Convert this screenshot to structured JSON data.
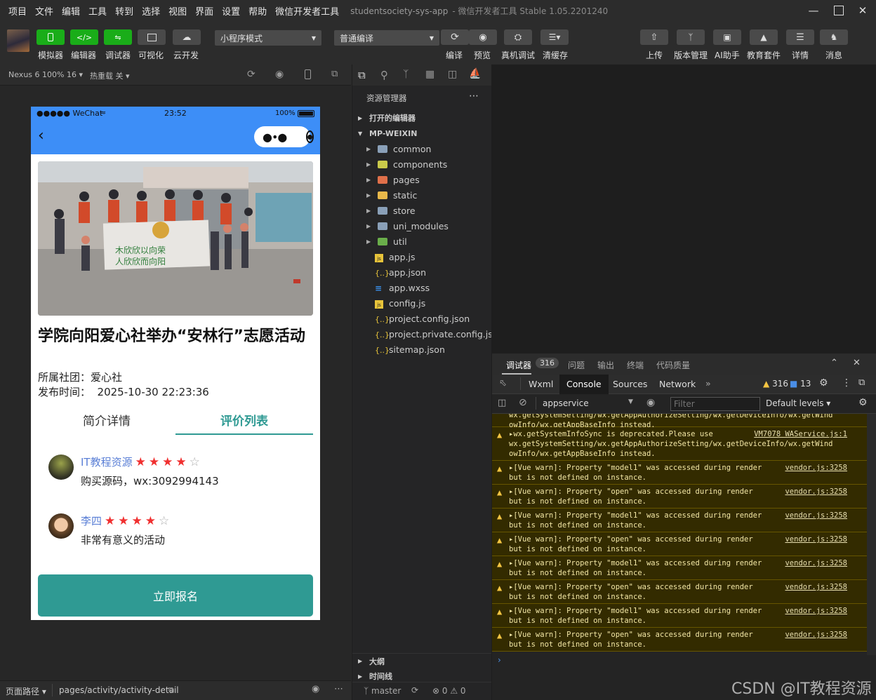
{
  "menu": [
    "项目",
    "文件",
    "编辑",
    "工具",
    "转到",
    "选择",
    "视图",
    "界面",
    "设置",
    "帮助",
    "微信开发者工具"
  ],
  "window": {
    "title": "studentsociety-sys-app",
    "subtitle": "- 微信开发者工具 Stable 1.05.2201240"
  },
  "toolbar": {
    "left_labels": [
      "模拟器",
      "编辑器",
      "调试器",
      "可视化",
      "云开发"
    ],
    "mode_select": "小程序模式",
    "compile_select": "普通编译",
    "mid_labels": [
      "编译",
      "预览",
      "真机调试",
      "清缓存"
    ],
    "right_labels": [
      "上传",
      "版本管理",
      "AI助手",
      "教育套件",
      "详情",
      "消息"
    ]
  },
  "simbar": {
    "device": "Nexus 6 100% 16",
    "hotreload": "热重载 关"
  },
  "phone": {
    "carrier": "●●●●● WeChat",
    "time": "23:52",
    "battery": "100%",
    "activity_title": "学院向阳爱心社举办“安林行”志愿活动",
    "club": "所属社团：爱心社",
    "publish": "发布时间：  2025-10-30 22:23:36",
    "tabs": [
      "简介详情",
      "评价列表"
    ],
    "reviews": [
      {
        "user": "IT教程资源",
        "stars": 4,
        "text": "购买源码，wx:3092994143"
      },
      {
        "user": "李四",
        "stars": 4,
        "text": "非常有意义的活动"
      }
    ],
    "signup_button": "立即报名",
    "banner_text_1": "木欣欣以向荣",
    "banner_text_2": "人欣欣而向阳"
  },
  "left_status": {
    "page_path_label": "页面路径",
    "page_path": "pages/activity/activity-detail"
  },
  "explorer": {
    "title": "资源管理器",
    "open_editors": "打开的编辑器",
    "root": "MP-WEIXIN",
    "folders": [
      "common",
      "components",
      "pages",
      "static",
      "store",
      "uni_modules",
      "util"
    ],
    "files": [
      "app.js",
      "app.json",
      "app.wxss",
      "config.js",
      "project.config.json",
      "project.private.config.js...",
      "sitemap.json"
    ],
    "outline": "大纲",
    "timeline": "时间线",
    "branch": "master",
    "problems": "⊗ 0 ⚠ 0"
  },
  "devtools": {
    "top_tabs": [
      "调试器",
      "问题",
      "输出",
      "终端",
      "代码质量"
    ],
    "debugger_badge": "316",
    "panel_tabs": [
      "Wxml",
      "Console",
      "Sources",
      "Network"
    ],
    "warn_count": "316",
    "info_count": "13",
    "context": "appservice",
    "filter_placeholder": "Filter",
    "levels": "Default levels",
    "messages": [
      {
        "line1": "wx.getSystemSetting/wx.getAppAuthorizeSetting/wx.getDeviceInfo/wx.getWind",
        "line2": "owInfo/wx.getAppBaseInfo instead.",
        "src": "",
        "partial": true
      },
      {
        "line1": "▸wx.getSystemInfoSync is deprecated.Please use",
        "line1b": "wx.getSystemSetting/wx.getAppAuthorizeSetting/wx.getDeviceInfo/wx.getWind",
        "line2": "owInfo/wx.getAppBaseInfo instead.",
        "src": "VM7078 WAService.js:1"
      },
      {
        "line1": "▸[Vue warn]: Property \"model1\" was accessed during render",
        "line2": "but is not defined on instance.",
        "src": "vendor.js:3258"
      },
      {
        "line1": "▸[Vue warn]: Property \"open\" was accessed during render",
        "line2": "but is not defined on instance.",
        "src": "vendor.js:3258"
      },
      {
        "line1": "▸[Vue warn]: Property \"model1\" was accessed during render",
        "line2": "but is not defined on instance.",
        "src": "vendor.js:3258"
      },
      {
        "line1": "▸[Vue warn]: Property \"open\" was accessed during render",
        "line2": "but is not defined on instance.",
        "src": "vendor.js:3258"
      },
      {
        "line1": "▸[Vue warn]: Property \"model1\" was accessed during render",
        "line2": "but is not defined on instance.",
        "src": "vendor.js:3258"
      },
      {
        "line1": "▸[Vue warn]: Property \"open\" was accessed during render",
        "line2": "but is not defined on instance.",
        "src": "vendor.js:3258"
      },
      {
        "line1": "▸[Vue warn]: Property \"model1\" was accessed during render",
        "line2": "but is not defined on instance.",
        "src": "vendor.js:3258"
      },
      {
        "line1": "▸[Vue warn]: Property \"open\" was accessed during render",
        "line2": "but is not defined on instance.",
        "src": "vendor.js:3258"
      }
    ]
  },
  "watermark": "CSDN @IT教程资源",
  "colors": {
    "accent_green": "#1aad19",
    "wechat_blue": "#3d8ef7",
    "teal": "#2f9a93",
    "link_blue": "#5a7fd6",
    "star_red": "#f03030"
  }
}
